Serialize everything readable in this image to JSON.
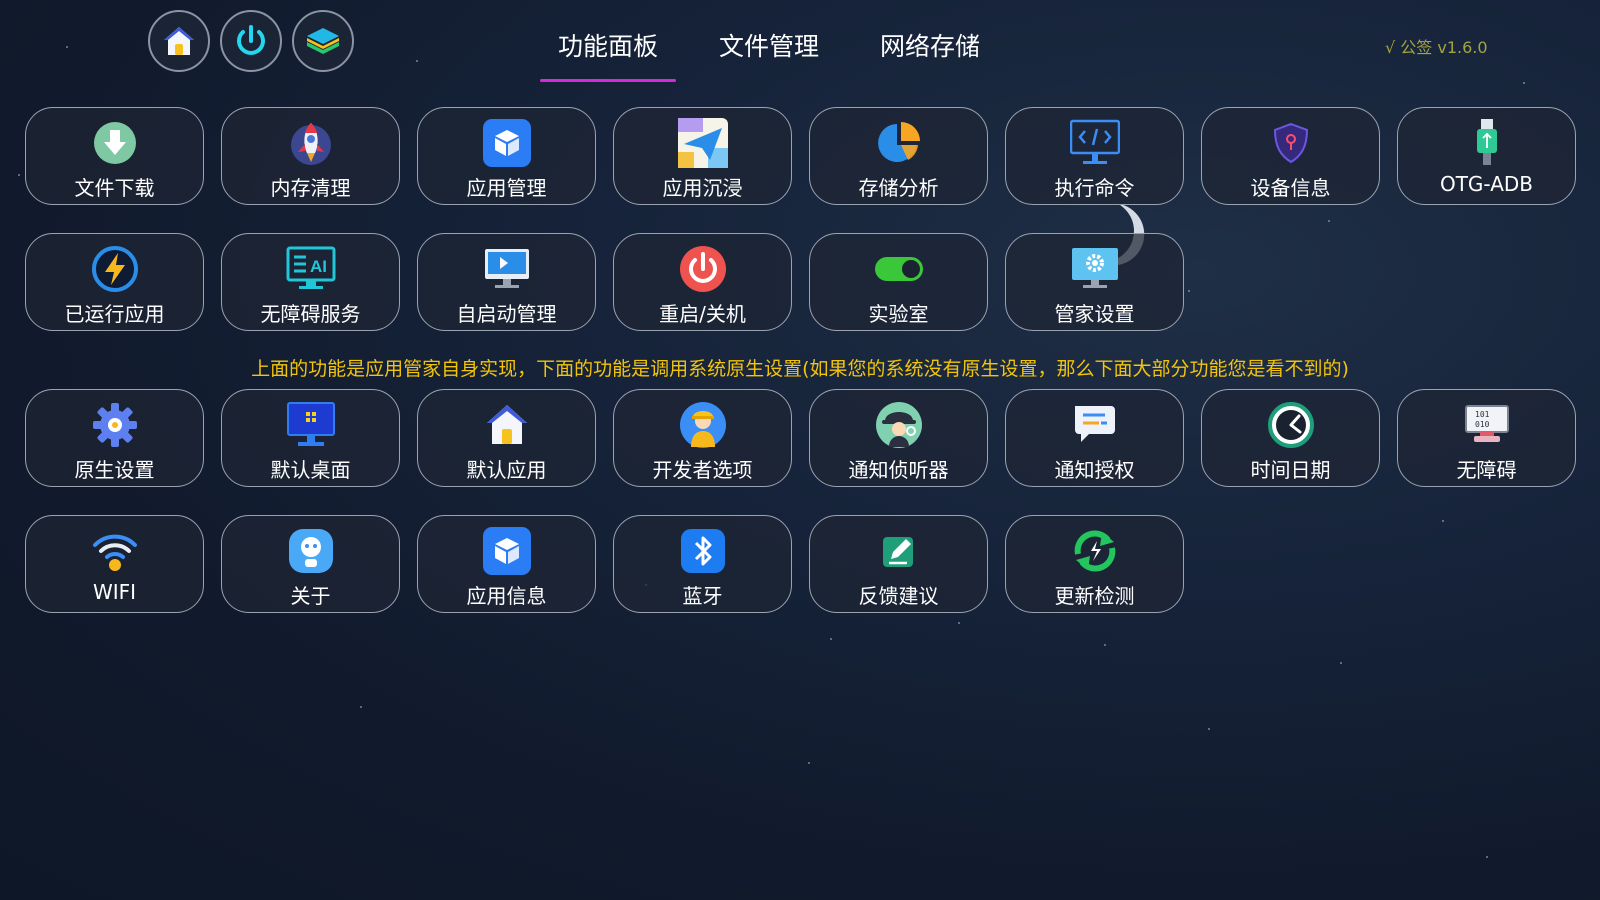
{
  "header": {
    "top_icons": [
      {
        "name": "home-icon"
      },
      {
        "name": "power-icon"
      },
      {
        "name": "layers-icon"
      }
    ],
    "tabs": [
      {
        "label": "功能面板",
        "active": true
      },
      {
        "label": "文件管理",
        "active": false
      },
      {
        "label": "网络存储",
        "active": false
      }
    ],
    "version": "√ 公签 v1.6.0",
    "accent_color": "#d32bd8"
  },
  "grid_self": {
    "items": [
      {
        "label": "文件下载",
        "icon": "download-icon"
      },
      {
        "label": "内存清理",
        "icon": "rocket-icon"
      },
      {
        "label": "应用管理",
        "icon": "cube-icon"
      },
      {
        "label": "应用沉浸",
        "icon": "paper-plane-icon"
      },
      {
        "label": "存储分析",
        "icon": "pie-chart-icon"
      },
      {
        "label": "执行命令",
        "icon": "code-monitor-icon"
      },
      {
        "label": "设备信息",
        "icon": "shield-icon"
      },
      {
        "label": "OTG-ADB",
        "icon": "usb-icon"
      },
      {
        "label": "已运行应用",
        "icon": "lightning-icon"
      },
      {
        "label": "无障碍服务",
        "icon": "ai-screen-icon"
      },
      {
        "label": "自启动管理",
        "icon": "monitor-play-icon"
      },
      {
        "label": "重启/关机",
        "icon": "power-icon"
      },
      {
        "label": "实验室",
        "icon": "toggle-icon"
      },
      {
        "label": "管家设置",
        "icon": "settings-monitor-icon"
      }
    ]
  },
  "notice": "上面的功能是应用管家自身实现，下面的功能是调用系统原生设置(如果您的系统没有原生设置，那么下面大部分功能您是看不到的)",
  "grid_native": {
    "items": [
      {
        "label": "原生设置",
        "icon": "gear-icon"
      },
      {
        "label": "默认桌面",
        "icon": "desktop-icon"
      },
      {
        "label": "默认应用",
        "icon": "home-icon"
      },
      {
        "label": "开发者选项",
        "icon": "developer-icon"
      },
      {
        "label": "通知侦听器",
        "icon": "detective-icon"
      },
      {
        "label": "通知授权",
        "icon": "chat-icon"
      },
      {
        "label": "时间日期",
        "icon": "clock-icon"
      },
      {
        "label": "无障碍",
        "icon": "binary-monitor-icon"
      },
      {
        "label": "WIFI",
        "icon": "wifi-icon"
      },
      {
        "label": "关于",
        "icon": "info-face-icon"
      },
      {
        "label": "应用信息",
        "icon": "cube-icon"
      },
      {
        "label": "蓝牙",
        "icon": "bluetooth-icon"
      },
      {
        "label": "反馈建议",
        "icon": "edit-icon"
      },
      {
        "label": "更新检测",
        "icon": "refresh-icon"
      }
    ]
  }
}
